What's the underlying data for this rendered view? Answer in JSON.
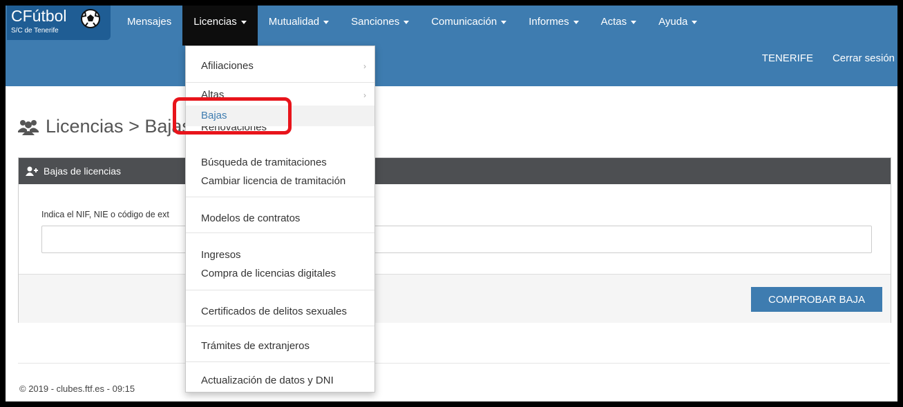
{
  "brand": {
    "name": "CFútbol",
    "sub": "S/C de Tenerife"
  },
  "nav": {
    "items": [
      {
        "label": "Mensajes",
        "caret": false
      },
      {
        "label": "Licencias",
        "caret": true
      },
      {
        "label": "Mutualidad",
        "caret": true
      },
      {
        "label": "Sanciones",
        "caret": true
      },
      {
        "label": "Comunicación",
        "caret": true
      },
      {
        "label": "Informes",
        "caret": true
      },
      {
        "label": "Actas",
        "caret": true
      },
      {
        "label": "Ayuda",
        "caret": true
      }
    ],
    "user": "TENERIFE",
    "logout": "Cerrar sesión"
  },
  "page": {
    "title": "Licencias > Bajas",
    "panel_title": "Bajas de licencias",
    "input_label": "Indica el NIF, NIE o código de ext",
    "input_value": "",
    "button": "COMPROBAR BAJA",
    "footer": "© 2019 - clubes.ftf.es - 09:15"
  },
  "menu": {
    "afiliaciones": "Afiliaciones",
    "altas": "Altas",
    "bajas": "Bajas",
    "renovaciones": "Renovaciones",
    "busqueda": "Búsqueda de tramitaciones",
    "cambiar": "Cambiar licencia de tramitación",
    "modelos": "Modelos de contratos",
    "ingresos": "Ingresos",
    "compra": "Compra de licencias digitales",
    "certificados": "Certificados de delitos sexuales",
    "tramites": "Trámites de extranjeros",
    "actualizacion": "Actualización de datos y DNI"
  },
  "colors": {
    "nav": "#3e7cb0",
    "brand": "#1f5d94",
    "active_tab": "#0d0d0d",
    "panel_header": "#4d4f52",
    "highlight": "#e8141b"
  },
  "icons": {
    "brand": "soccer-ball-icon",
    "title": "users-icon",
    "panel": "user-plus-icon",
    "submenu": "chevron-right-icon"
  }
}
